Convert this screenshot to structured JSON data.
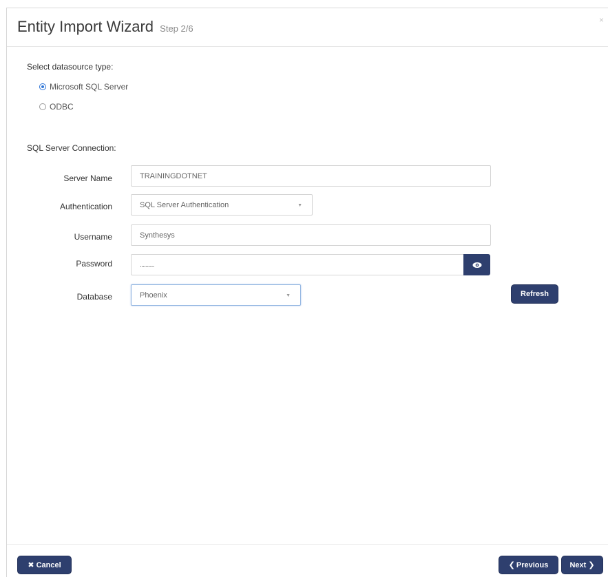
{
  "header": {
    "title": "Entity Import Wizard",
    "step": "Step 2/6",
    "close_icon": "×"
  },
  "datasource": {
    "label": "Select datasource type:",
    "options": [
      {
        "label": "Microsoft SQL Server",
        "checked": true
      },
      {
        "label": "ODBC",
        "checked": false
      }
    ]
  },
  "connection": {
    "section_label": "SQL Server Connection:",
    "server_name": {
      "label": "Server Name",
      "value": "TRAININGDOTNET"
    },
    "authentication": {
      "label": "Authentication",
      "value": "SQL Server Authentication"
    },
    "username": {
      "label": "Username",
      "value": "Synthesys"
    },
    "password": {
      "label": "Password",
      "value": "..........",
      "toggle_icon": "eye-icon"
    },
    "database": {
      "label": "Database",
      "value": "Phoenix"
    },
    "refresh_label": "Refresh"
  },
  "footer": {
    "cancel_label": "Cancel",
    "previous_label": "Previous",
    "next_label": "Next"
  },
  "colors": {
    "primary_button": "#2e3f6e",
    "radio_accent": "#2f75d6"
  }
}
